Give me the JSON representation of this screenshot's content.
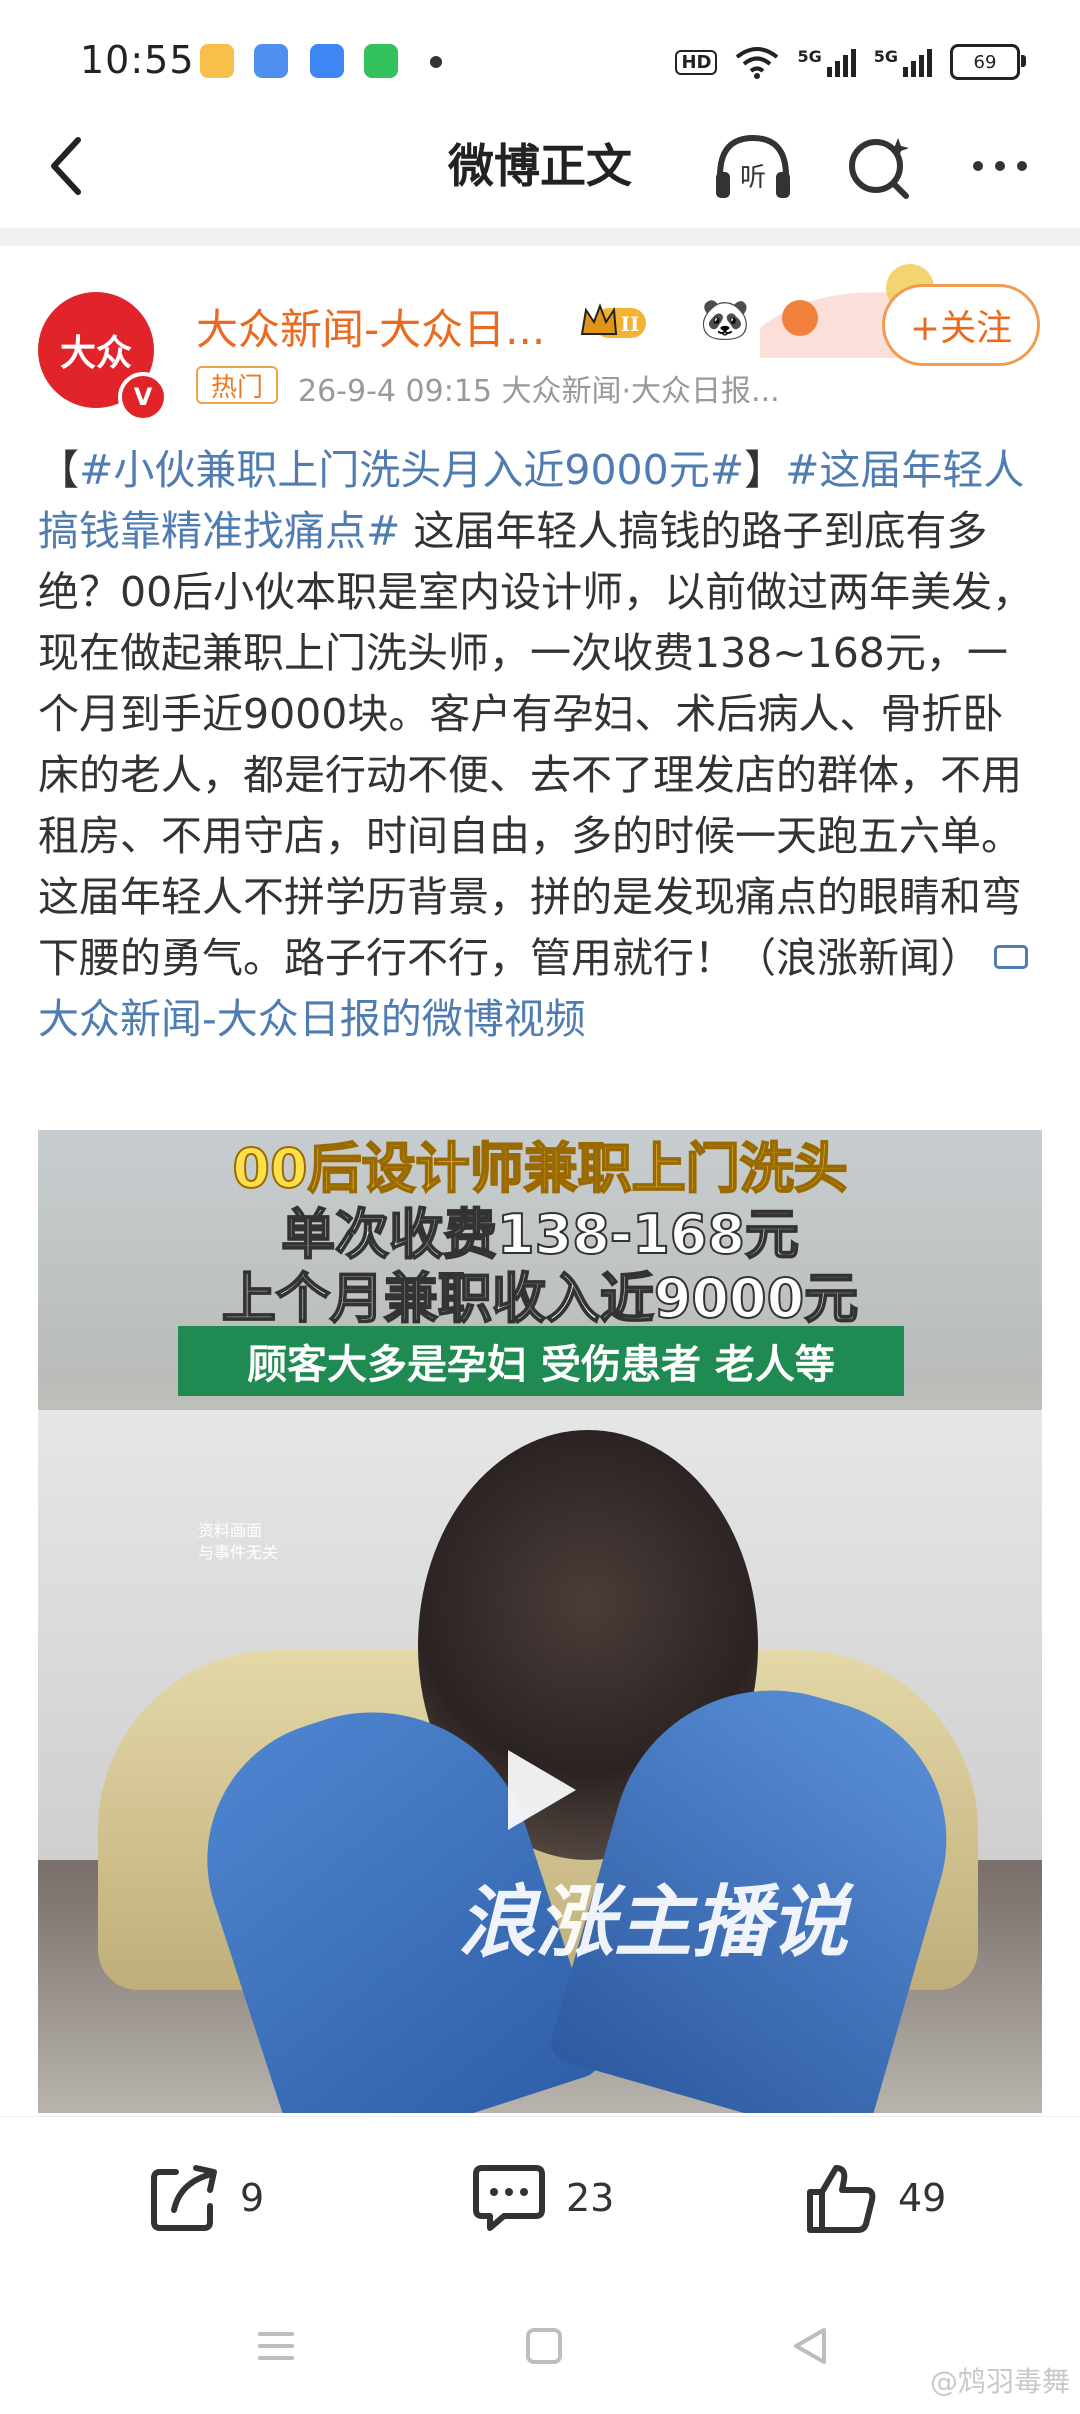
{
  "status_bar": {
    "time": "10:55",
    "hd": "HD",
    "net1": "5G",
    "net2": "5G",
    "battery": "69",
    "app_icon_colors": [
      "#f3a531",
      "#4f8ff0",
      "#3d86f4",
      "#33c25b"
    ]
  },
  "nav": {
    "title": "微博正文",
    "listen_label": "听"
  },
  "author": {
    "name": "大众新闻-大众日...",
    "avatar_text": "大众",
    "verified_badge": "V",
    "level": "II",
    "follow_label": "+关注",
    "hot_tag": "热门",
    "meta": "26-9-4 09:15  大众新闻·大众日报..."
  },
  "post": {
    "bracket_open": "【",
    "hashtag1": "#小伙兼职上门洗头月入近9000元#",
    "bracket_close": "】",
    "hashtag2": "#这届年轻人搞钱靠精准找痛点#",
    "body": " 这届年轻人搞钱的路子到底有多绝？00后小伙本职是室内设计师，以前做过两年美发，现在做起兼职上门洗头师，一次收费138~168元，一个月到手近9000块。客户有孕妇、术后病人、骨折卧床的老人，都是行动不便、去不了理发店的群体，不用租房、不用守店，时间自由，多的时候一天跑五六单。这届年轻人不拼学历背景，拼的是发现痛点的眼睛和弯下腰的勇气。路子行不行，管用就行！（浪涨新闻）",
    "video_link": "大众新闻-大众日报的微博视频"
  },
  "video": {
    "caption1": "00后设计师兼职上门洗头",
    "caption2": "单次收费138-168元",
    "caption3": "上个月兼职收入近9000元",
    "caption4": "顾客大多是孕妇 受伤患者 老人等",
    "note": "资料画面\n与事件无关",
    "watermark": "浪涨主播说"
  },
  "actions": {
    "share_count": "9",
    "comment_count": "23",
    "like_count": "49"
  },
  "watermark": "@鸩羽毒舞",
  "colors": {
    "accent_orange": "#ea6a1f",
    "link_blue": "#4f7cb1",
    "brand_red": "#e1232a"
  }
}
